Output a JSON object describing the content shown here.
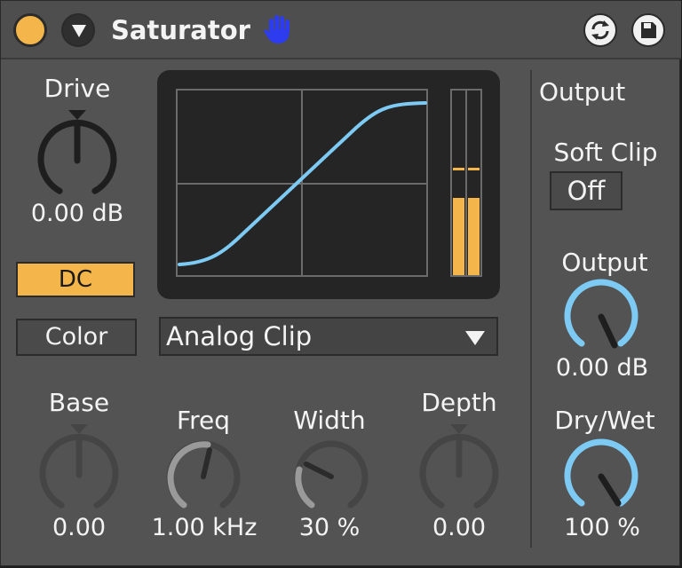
{
  "device": {
    "title": "Saturator",
    "activator_color": "#f4b64b",
    "accent": "#7dcbf4",
    "icons": {
      "activator": "activator-dot",
      "fold": "triangle-down-icon",
      "hand": "hand-icon",
      "hotswap": "hotswap-icon",
      "save": "save-icon"
    }
  },
  "drive": {
    "label": "Drive",
    "value": "0.00 dB"
  },
  "display": {
    "curve_color": "#7dcbf4",
    "meter_color": "#f4b64b",
    "meter_level": 0.42,
    "meter_peak": 0.58
  },
  "dc": {
    "label": "DC",
    "active": true
  },
  "color": {
    "label": "Color",
    "active": false
  },
  "type_select": {
    "value": "Analog Clip"
  },
  "base": {
    "label": "Base",
    "value": "0.00"
  },
  "freq": {
    "label": "Freq",
    "value": "1.00 kHz"
  },
  "width": {
    "label": "Width",
    "value": "30 %"
  },
  "depth": {
    "label": "Depth",
    "value": "0.00"
  },
  "output_section": {
    "heading": "Output",
    "soft_clip_label": "Soft Clip",
    "soft_clip_value": "Off",
    "output": {
      "label": "Output",
      "value": "0.00 dB"
    },
    "dry_wet": {
      "label": "Dry/Wet",
      "value": "100 %"
    }
  }
}
